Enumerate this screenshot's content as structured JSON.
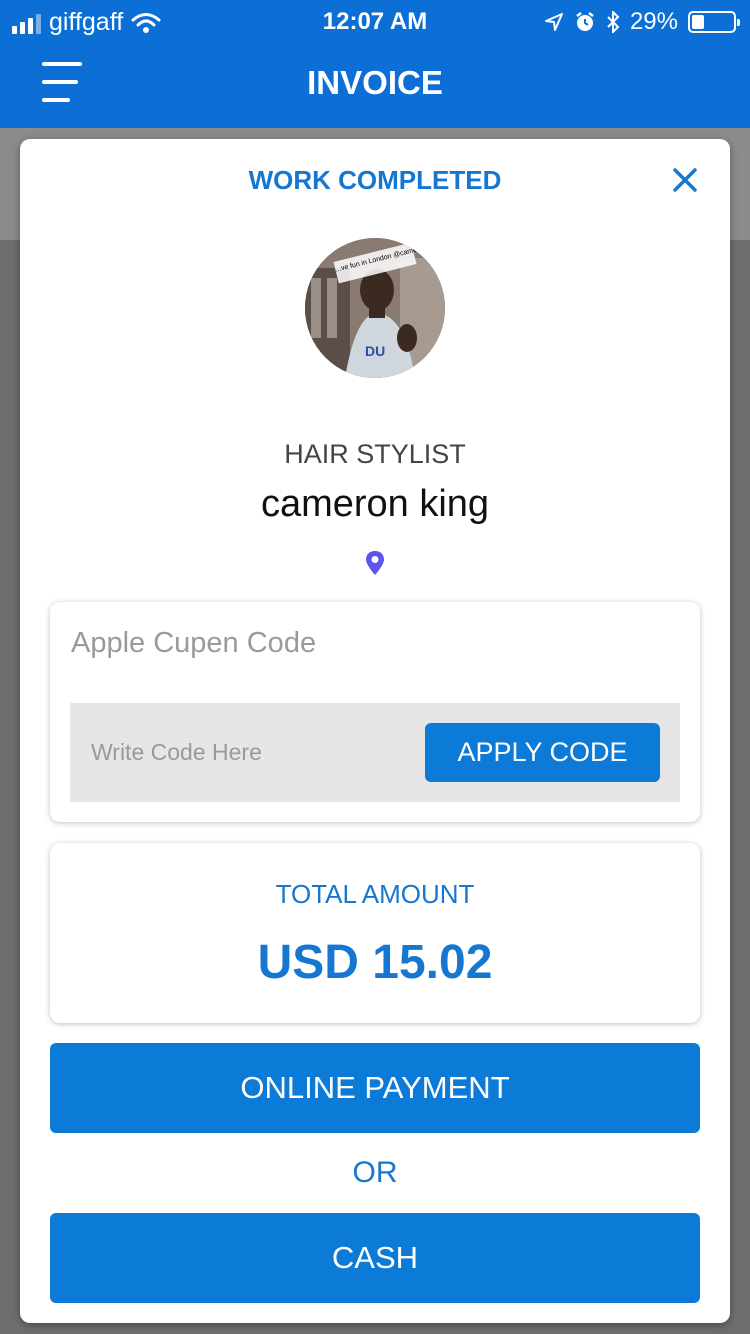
{
  "status_bar": {
    "carrier": "giffgaff",
    "time": "12:07 AM",
    "battery_percent": "29%",
    "battery_level": 0.29,
    "icons": [
      "signal-icon",
      "wifi-icon",
      "location-arrow-icon",
      "alarm-icon",
      "bluetooth-icon",
      "battery-icon"
    ]
  },
  "header": {
    "title": "INVOICE",
    "menu_icon": "hamburger-menu-icon"
  },
  "modal": {
    "title": "WORK COMPLETED",
    "close_icon": "close-icon",
    "avatar_caption": "...ve fun in London @cameronyking",
    "role": "HAIR STYLIST",
    "name": "cameron king",
    "location_icon": "map-pin-icon"
  },
  "coupon": {
    "title": "Apple Cupen Code",
    "input_value": "",
    "input_placeholder": "Write Code Here",
    "apply_label": "APPLY CODE"
  },
  "total": {
    "label": "TOTAL AMOUNT",
    "value": "USD 15.02"
  },
  "actions": {
    "online_payment_label": "ONLINE PAYMENT",
    "or_label": "OR",
    "cash_label": "CASH"
  },
  "colors": {
    "primary": "#0c7bd8",
    "header_blue": "#0c6fd6",
    "text_blue": "#1677d2",
    "pin_purple": "#5b54f0"
  }
}
